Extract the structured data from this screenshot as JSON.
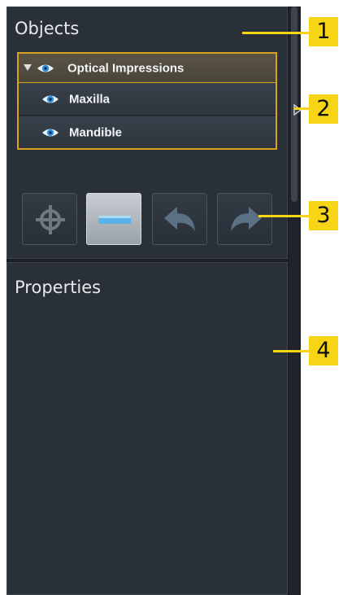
{
  "objects_panel": {
    "title": "Objects",
    "tree": {
      "parent": {
        "label": "Optical Impressions",
        "icon": "eye-icon"
      },
      "children": [
        {
          "label": "Maxilla",
          "icon": "eye-icon"
        },
        {
          "label": "Mandible",
          "icon": "eye-icon"
        }
      ]
    },
    "toolbar": [
      {
        "icon": "crosshair-icon"
      },
      {
        "icon": "minus-icon",
        "active": true
      },
      {
        "icon": "undo-icon"
      },
      {
        "icon": "redo-icon"
      }
    ]
  },
  "properties_panel": {
    "title": "Properties"
  },
  "callouts": [
    "1",
    "2",
    "3",
    "4"
  ],
  "colors": {
    "selection_border": "#d8a21a",
    "callout": "#f5d515",
    "panel_bg": "#2a3038",
    "eye_icon": "#2f8fe0"
  }
}
